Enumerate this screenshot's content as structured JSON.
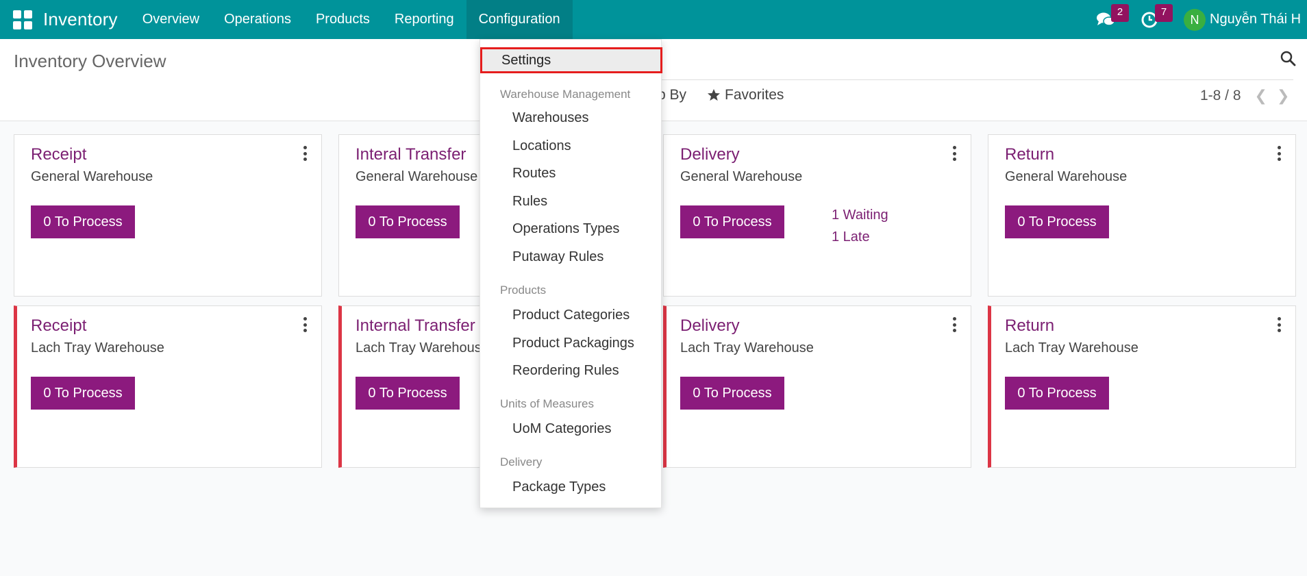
{
  "navbar": {
    "brand": "Inventory",
    "menu": [
      "Overview",
      "Operations",
      "Products",
      "Reporting",
      "Configuration"
    ],
    "messages_count": "2",
    "activities_count": "7",
    "avatar_initial": "N",
    "user_name": "Nguyễn Thái H",
    "color": "#00939a"
  },
  "control": {
    "title": "Inventory Overview",
    "groupby_partial": "p By",
    "favorites": "Favorites",
    "pager": "1-8 / 8"
  },
  "cards": [
    {
      "title": "Receipt",
      "warehouse": "General Warehouse",
      "button": "0 To Process"
    },
    {
      "title": "Interal Transfer",
      "warehouse": "General Warehouse",
      "button": "0 To Process"
    },
    {
      "title": "Delivery",
      "warehouse": "General Warehouse",
      "button": "0 To Process",
      "waiting": "1 Waiting",
      "late": "1 Late"
    },
    {
      "title": "Return",
      "warehouse": "General Warehouse",
      "button": "0 To Process"
    },
    {
      "title": "Receipt",
      "warehouse": "Lach Tray Warehouse",
      "button": "0 To Process"
    },
    {
      "title": "Internal Transfer",
      "warehouse": "Lach Tray Warehous",
      "button": "0 To Process"
    },
    {
      "title": "Delivery",
      "warehouse": "Lach Tray Warehouse",
      "button": "0 To Process"
    },
    {
      "title": "Return",
      "warehouse": "Lach Tray Warehouse",
      "button": "0 To Process"
    }
  ],
  "dropdown": {
    "settings": "Settings",
    "sections": [
      {
        "header": "Warehouse Management",
        "items": [
          "Warehouses",
          "Locations",
          "Routes",
          "Rules",
          "Operations Types",
          "Putaway Rules"
        ]
      },
      {
        "header": "Products",
        "items": [
          "Product Categories",
          "Product Packagings",
          "Reordering Rules"
        ]
      },
      {
        "header": "Units of Measures",
        "items": [
          "UoM Categories"
        ]
      },
      {
        "header": "Delivery",
        "items": [
          "Package Types"
        ]
      }
    ]
  },
  "colors": {
    "accent": "#8c1a7e",
    "title": "#7b1f72",
    "alert_border": "#dc3545"
  }
}
